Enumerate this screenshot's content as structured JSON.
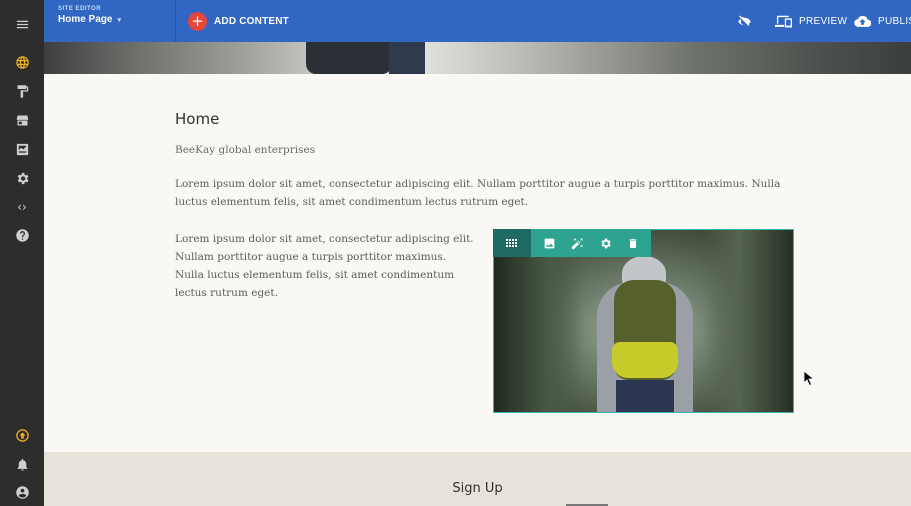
{
  "topbar": {
    "site_editor_caption": "SITE EDITOR",
    "page_selector": "Home Page",
    "page_selector_caret": "▾",
    "add_content_label": "ADD CONTENT",
    "preview_label": "PREVIEW",
    "publish_label": "PUBLISH"
  },
  "rail": {
    "items": [
      {
        "icon": "menu-icon"
      },
      {
        "icon": "globe-icon",
        "active": true
      },
      {
        "icon": "paint-roller-icon"
      },
      {
        "icon": "store-icon"
      },
      {
        "icon": "blog-icon"
      },
      {
        "icon": "gear-icon"
      },
      {
        "icon": "code-icon",
        "glyph": "‹›"
      },
      {
        "icon": "help-icon"
      },
      {
        "icon": "upgrade-icon",
        "active": true
      },
      {
        "icon": "bell-icon"
      },
      {
        "icon": "account-icon"
      }
    ]
  },
  "page": {
    "title": "Home",
    "subtitle": "BeeKay global enterprises",
    "paragraph_1": "Lorem ipsum dolor sit amet, consectetur adipiscing elit. Nullam porttitor augue a turpis porttitor maximus. Nulla luctus elementum felis, sit amet condimentum lectus rutrum eget.",
    "paragraph_2": "Lorem ipsum dolor sit amet, consectetur adipiscing elit. Nullam porttitor augue a turpis porttitor maximus. Nulla luctus elementum felis, sit amet condimentum lectus rutrum eget.",
    "signup_title": "Sign Up"
  },
  "image_toolbar": {
    "tools": [
      "drag-handle-icon",
      "image-icon",
      "magic-wand-icon",
      "gear-icon",
      "trash-icon"
    ]
  },
  "colors": {
    "topbar": "#3166c3",
    "rail": "#2d2d2d",
    "rail_active": "#f2b51f",
    "add_button": "#e4463a",
    "image_toolbar": "#2fa391",
    "image_toolbar_drag": "#1f6a63",
    "signup_band": "#e6e4da"
  }
}
